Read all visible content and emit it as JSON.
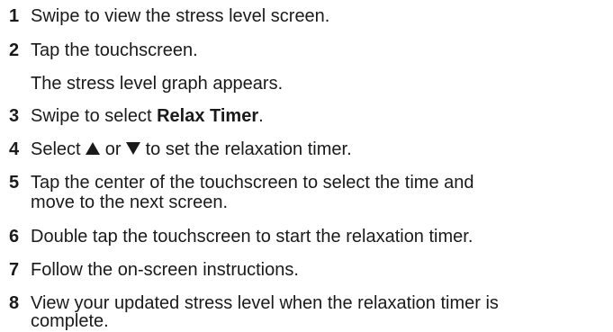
{
  "steps": [
    {
      "number": "1",
      "text": "Swipe to view the stress level screen."
    },
    {
      "number": "2",
      "text": "Tap the touchscreen.",
      "result": "The stress level graph appears."
    },
    {
      "number": "3",
      "prefix": "Swipe to select ",
      "bold": "Relax Timer",
      "suffix": "."
    },
    {
      "number": "4",
      "prefix": "Select ",
      "middle": " or ",
      "suffix": " to set the relaxation timer.",
      "icons": [
        "triangle-up-icon",
        "triangle-down-icon"
      ]
    },
    {
      "number": "5",
      "line1": "Tap the center of the touchscreen to select the time and",
      "line2": "move to the next screen."
    },
    {
      "number": "6",
      "text": "Double tap the touchscreen to start the relaxation timer."
    },
    {
      "number": "7",
      "text": "Follow the on-screen instructions."
    },
    {
      "number": "8",
      "line1": "View your updated stress level when the relaxation timer is",
      "line2": "complete."
    }
  ],
  "colors": {
    "text": "#1a1a1a",
    "background": "#ffffff"
  }
}
